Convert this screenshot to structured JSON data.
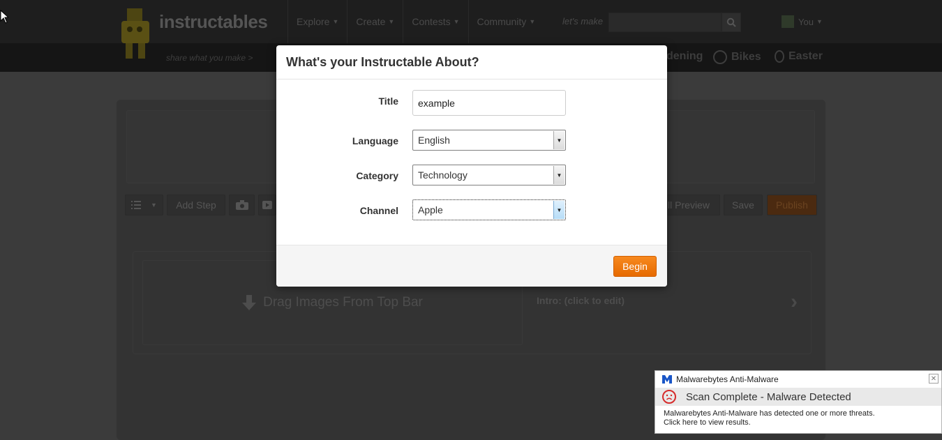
{
  "header": {
    "logo_text": "instructables",
    "tagline": "share what you make >",
    "nav": [
      {
        "label": "Explore"
      },
      {
        "label": "Create"
      },
      {
        "label": "Contests"
      },
      {
        "label": "Community"
      }
    ],
    "lets_make": "let's make",
    "user_label": "You"
  },
  "subbar": {
    "items": [
      {
        "label": "dening"
      },
      {
        "label": "Bikes"
      },
      {
        "label": "Easter"
      }
    ]
  },
  "editor": {
    "toolbar": {
      "add_step": "Add Step",
      "preview": "ll Preview",
      "save": "Save",
      "publish": "Publish"
    },
    "drop_text": "Drag Images From Top Bar",
    "intro_label": "Intro: (click to edit)"
  },
  "modal": {
    "title": "What's your Instructable About?",
    "title_label": "Title",
    "title_value": "example",
    "language_label": "Language",
    "language_value": "English",
    "category_label": "Category",
    "category_value": "Technology",
    "channel_label": "Channel",
    "channel_value": "Apple",
    "begin_label": "Begin"
  },
  "notification": {
    "app_name": "Malwarebytes Anti-Malware",
    "headline": "Scan Complete - Malware Detected",
    "body_line1": "Malwarebytes Anti-Malware has detected one or more threats.",
    "body_line2": "Click here to view results.",
    "close_glyph": "✕"
  }
}
